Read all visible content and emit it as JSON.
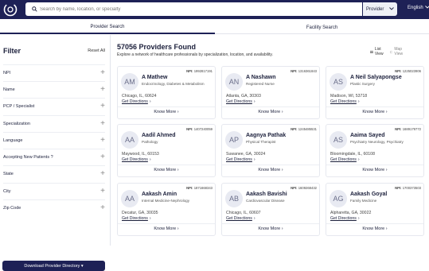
{
  "header": {
    "search_placeholder": "Search by name, location, or specialty",
    "provider_select": "Provider",
    "language": "English"
  },
  "tabs": [
    "Provider Search",
    "Facility Search"
  ],
  "filter": {
    "title": "Filter",
    "reset": "Reset All",
    "items": [
      "NPI",
      "Name",
      "PCP / Specialist",
      "Specialization",
      "Language",
      "Accepting New Patients ?",
      "State",
      "City",
      "Zip Code"
    ],
    "download_label": "Download Provider Directory ▾"
  },
  "results": {
    "title": "57056 Providers Found",
    "subtitle": "Explore a network of healthcare professionals by specialization, location, and availability.",
    "list_view": "List View",
    "map_view": "Map View",
    "get_directions": "Get Directions",
    "know_more": "Know More",
    "npi_label": "NPI:",
    "providers": [
      {
        "npi": "1992817191",
        "initials": "AM",
        "name": "A Mathew",
        "specialty": "Endocrinology, Diabetes & Metabolism",
        "location": "Chicago, IL, 60624"
      },
      {
        "npi": "1316361843",
        "initials": "AN",
        "name": "A Nashawn",
        "specialty": "Registered Nurse",
        "location": "Atlanta, GA, 30303"
      },
      {
        "npi": "1225023906",
        "initials": "AS",
        "name": "A Neil Salyapongse",
        "specialty": "Plastic Surgery",
        "location": "Madison, WI, 53718"
      },
      {
        "npi": "1407240059",
        "initials": "AA",
        "name": "Aadil Ahmed",
        "specialty": "Pathology",
        "location": "Maywood, IL, 60153"
      },
      {
        "npi": "1245485531",
        "initials": "AP",
        "name": "Aagnya Pathak",
        "specialty": "Physical Therapist",
        "location": "Suwanee, GA, 30024"
      },
      {
        "npi": "1689179772",
        "initials": "AS",
        "name": "Aaima Sayed",
        "specialty": "Psychiatry Neurology, Psychiatry",
        "location": "Bloomingdale, IL, 60108"
      },
      {
        "npi": "1871668343",
        "initials": "AA",
        "name": "Aakash Amin",
        "specialty": "Internal Medicine-Nephrology",
        "location": "Decatur, GA, 30035"
      },
      {
        "npi": "1609268432",
        "initials": "AB",
        "name": "Aakash Bavishi",
        "specialty": "Cardiovascular Disease",
        "location": "Chicago, IL, 60607"
      },
      {
        "npi": "1700373503",
        "initials": "AG",
        "name": "Aakash Goyal",
        "specialty": "Family Medicine",
        "location": "Alpharetta, GA, 30022"
      }
    ]
  }
}
